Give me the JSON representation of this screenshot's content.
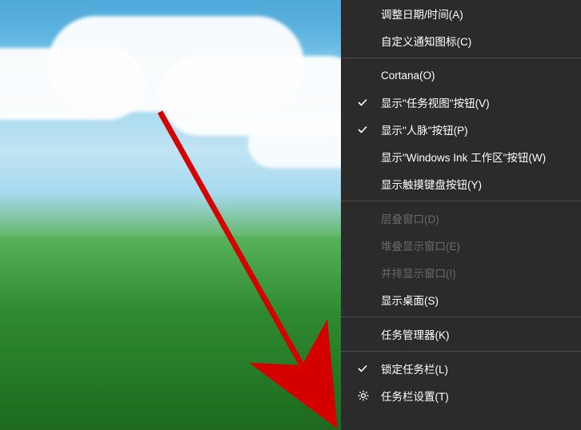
{
  "menu": {
    "groups": [
      {
        "items": [
          {
            "id": "adjust-datetime",
            "label": "调整日期/时间(A)",
            "checked": false,
            "disabled": false,
            "icon": null
          },
          {
            "id": "customize-notify-icons",
            "label": "自定义通知图标(C)",
            "checked": false,
            "disabled": false,
            "icon": null
          }
        ]
      },
      {
        "items": [
          {
            "id": "cortana",
            "label": "Cortana(O)",
            "checked": false,
            "disabled": false,
            "icon": null
          },
          {
            "id": "show-taskview-btn",
            "label": "显示\"任务视图\"按钮(V)",
            "checked": true,
            "disabled": false,
            "icon": null
          },
          {
            "id": "show-people-btn",
            "label": "显示\"人脉\"按钮(P)",
            "checked": true,
            "disabled": false,
            "icon": null
          },
          {
            "id": "show-ink-workspace-btn",
            "label": "显示\"Windows Ink 工作区\"按钮(W)",
            "checked": false,
            "disabled": false,
            "icon": null
          },
          {
            "id": "show-touch-keyboard-btn",
            "label": "显示触摸键盘按钮(Y)",
            "checked": false,
            "disabled": false,
            "icon": null
          }
        ]
      },
      {
        "items": [
          {
            "id": "cascade-windows",
            "label": "层叠窗口(D)",
            "checked": false,
            "disabled": true,
            "icon": null
          },
          {
            "id": "stack-windows",
            "label": "堆叠显示窗口(E)",
            "checked": false,
            "disabled": true,
            "icon": null
          },
          {
            "id": "side-by-side",
            "label": "并排显示窗口(I)",
            "checked": false,
            "disabled": true,
            "icon": null
          },
          {
            "id": "show-desktop",
            "label": "显示桌面(S)",
            "checked": false,
            "disabled": false,
            "icon": null
          }
        ]
      },
      {
        "items": [
          {
            "id": "task-manager",
            "label": "任务管理器(K)",
            "checked": false,
            "disabled": false,
            "icon": null
          }
        ]
      },
      {
        "items": [
          {
            "id": "lock-taskbar",
            "label": "锁定任务栏(L)",
            "checked": true,
            "disabled": false,
            "icon": null
          },
          {
            "id": "taskbar-settings",
            "label": "任务栏设置(T)",
            "checked": false,
            "disabled": false,
            "icon": "gear"
          }
        ]
      }
    ]
  },
  "annotation": {
    "arrow_color": "#d40000"
  }
}
